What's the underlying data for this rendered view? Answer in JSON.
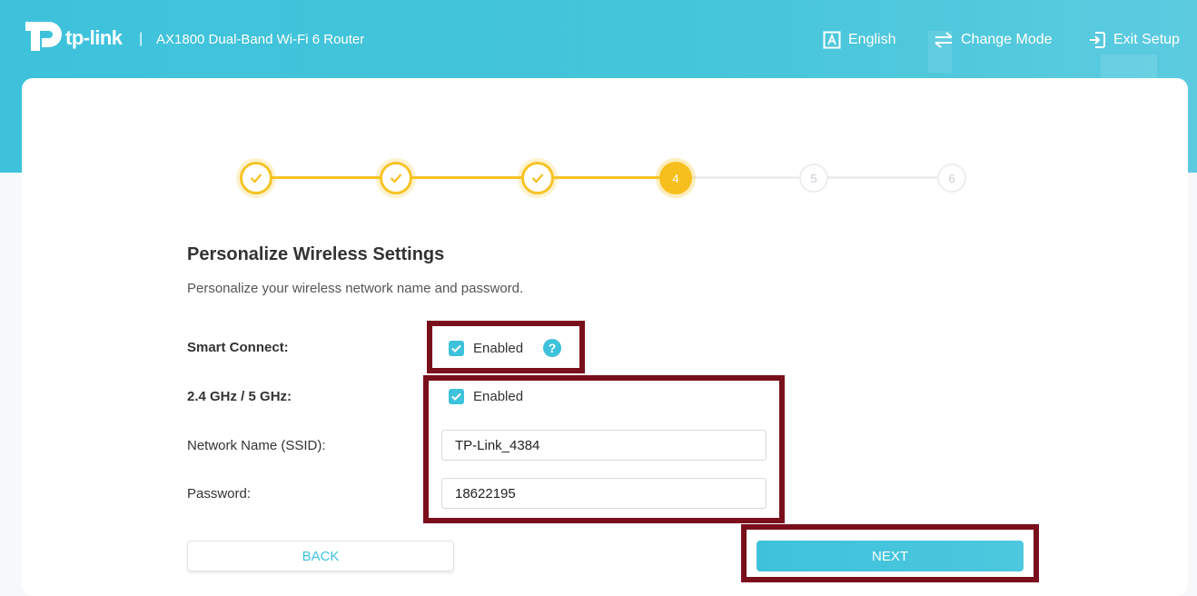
{
  "header": {
    "brand": "tp-link",
    "separator": "|",
    "model": "AX1800 Dual-Band Wi-Fi 6 Router",
    "language_label": "English",
    "change_mode_label": "Change Mode",
    "exit_label": "Exit Setup"
  },
  "stepper": {
    "steps": [
      {
        "state": "done",
        "label": ""
      },
      {
        "state": "done",
        "label": ""
      },
      {
        "state": "done",
        "label": ""
      },
      {
        "state": "active",
        "label": "4"
      },
      {
        "state": "todo",
        "label": "5"
      },
      {
        "state": "todo",
        "label": "6"
      }
    ]
  },
  "page": {
    "title": "Personalize Wireless Settings",
    "subtitle": "Personalize your wireless network name and password."
  },
  "form": {
    "smart_connect_label": "Smart Connect:",
    "smart_connect_value": "Enabled",
    "band_label": "2.4 GHz / 5 GHz:",
    "band_value": "Enabled",
    "ssid_label": "Network Name (SSID):",
    "ssid_value": "TP-Link_4384",
    "password_label": "Password:",
    "password_value": "18622195",
    "help_glyph": "?"
  },
  "buttons": {
    "back": "BACK",
    "next": "NEXT"
  },
  "colors": {
    "accent": "#3ec2dc",
    "step_yellow": "#f6bf1e",
    "highlight": "#7a0f1c"
  }
}
